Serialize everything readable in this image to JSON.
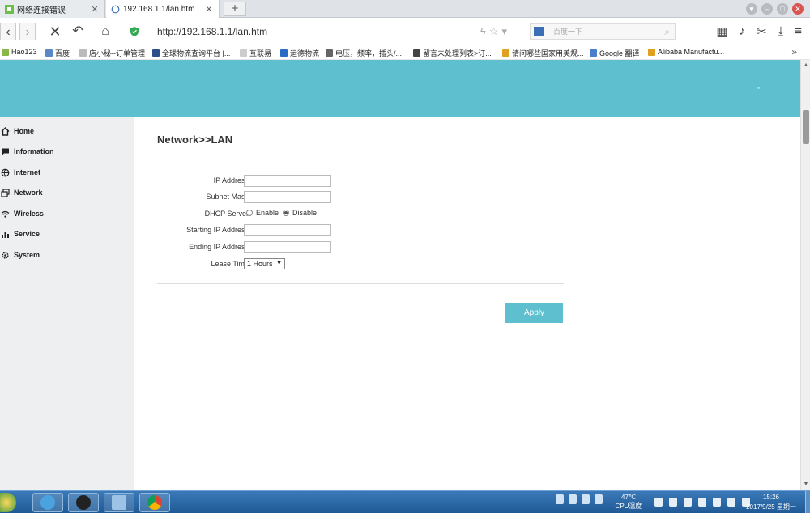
{
  "browser": {
    "tabs": [
      {
        "title": "网络连接错误",
        "active": false
      },
      {
        "title": "192.168.1.1/lan.htm",
        "active": true
      }
    ],
    "new_tab_label": "+",
    "url": "http://192.168.1.1/lan.htm",
    "search_placeholder": "百度一下",
    "bookmarks": [
      "Hao123",
      "百度",
      "店小秘--订单管理",
      "全球物流查询平台 |...",
      "互联易",
      "运德物流",
      "电压，频率，插头/...",
      "留言未处理列表>订...",
      "请问哪些国家用美规...",
      "Google 翻译",
      "Alibaba Manufactu..."
    ],
    "bookmarks_more": "»"
  },
  "sidebar": {
    "items": [
      {
        "label": "Home",
        "icon": "home-icon"
      },
      {
        "label": "Information",
        "icon": "chat-icon"
      },
      {
        "label": "Internet",
        "icon": "globe-icon"
      },
      {
        "label": "Network",
        "icon": "network-icon"
      },
      {
        "label": "Wireless",
        "icon": "wifi-icon"
      },
      {
        "label": "Service",
        "icon": "bar-chart-icon"
      },
      {
        "label": "System",
        "icon": "gear-icon"
      }
    ]
  },
  "main": {
    "title": "Network>>LAN",
    "fields": {
      "ip_address": {
        "label": "IP Address",
        "value": ""
      },
      "subnet_mask": {
        "label": "Subnet Mask",
        "value": ""
      },
      "dhcp_server": {
        "label": "DHCP Server",
        "enable": "Enable",
        "disable": "Disable",
        "selected": "Disable"
      },
      "start_ip": {
        "label": "Starting IP Address",
        "value": ""
      },
      "end_ip": {
        "label": "Ending IP Address",
        "value": ""
      },
      "lease_time": {
        "label": "Lease Time",
        "value": "1 Hours"
      }
    },
    "apply_label": "Apply"
  },
  "taskbar": {
    "temperature": "47℃",
    "temp_label": "CPU温度",
    "time": "15:26",
    "date": "2017/9/25 星期一"
  },
  "colors": {
    "accent": "#5ec0cf",
    "sidebar_bg": "#eeeff1"
  }
}
